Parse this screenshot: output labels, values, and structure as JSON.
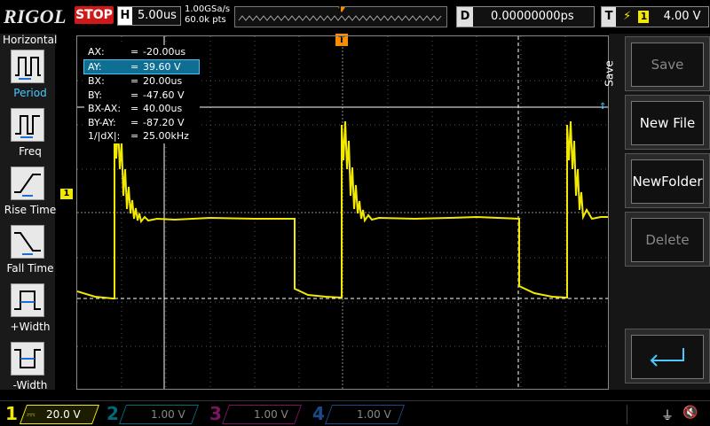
{
  "header": {
    "logo": "RIGOL",
    "run_state": "STOP",
    "timebase_label": "H",
    "timebase_value": "5.00us",
    "sample_rate": "1.00GSa/s",
    "memory_depth": "60.0k pts",
    "delay_label": "D",
    "delay_value": "0.00000000ps",
    "trigger_label": "T",
    "trigger_channel": "1",
    "trigger_level": "4.00 V"
  },
  "left_menu": {
    "title": "Horizontal",
    "items": [
      {
        "label": "Period"
      },
      {
        "label": "Freq"
      },
      {
        "label": "Rise Time"
      },
      {
        "label": "Fall Time"
      },
      {
        "label": "+Width"
      },
      {
        "label": "-Width"
      }
    ]
  },
  "cursor_table": [
    {
      "key": "AX:",
      "value": "-20.00us"
    },
    {
      "key": "AY:",
      "value": "39.60 V"
    },
    {
      "key": "BX:",
      "value": "20.00us"
    },
    {
      "key": "BY:",
      "value": "-47.60 V"
    },
    {
      "key": "BX-AX:",
      "value": "40.00us"
    },
    {
      "key": "BY-AY:",
      "value": "-87.20 V"
    },
    {
      "key": "1/|dX|:",
      "value": "25.00kHz"
    }
  ],
  "markers": {
    "trigger_pos": "T",
    "ch1_marker": "1",
    "trigger_level_marker": "T"
  },
  "right_menu": {
    "title": "Save",
    "items": [
      {
        "label": "Save",
        "enabled": false
      },
      {
        "label": "New File",
        "enabled": true
      },
      {
        "label": "NewFolder",
        "enabled": true
      },
      {
        "label": "Delete",
        "enabled": false
      },
      {
        "label": "",
        "icon": "enter-icon"
      }
    ]
  },
  "channels": [
    {
      "num": "1",
      "scale": "20.0 V",
      "color": "#f2e900"
    },
    {
      "num": "2",
      "scale": "1.00 V",
      "color": "#00b4c8"
    },
    {
      "num": "3",
      "scale": "1.00 V",
      "color": "#d21ea0"
    },
    {
      "num": "4",
      "scale": "1.00 V",
      "color": "#2a6fd8"
    }
  ],
  "colors": {
    "trace": "#f2e900",
    "cursor": "#ffffff",
    "accent": "#4ac8ff",
    "trigger": "#ff8c00"
  }
}
